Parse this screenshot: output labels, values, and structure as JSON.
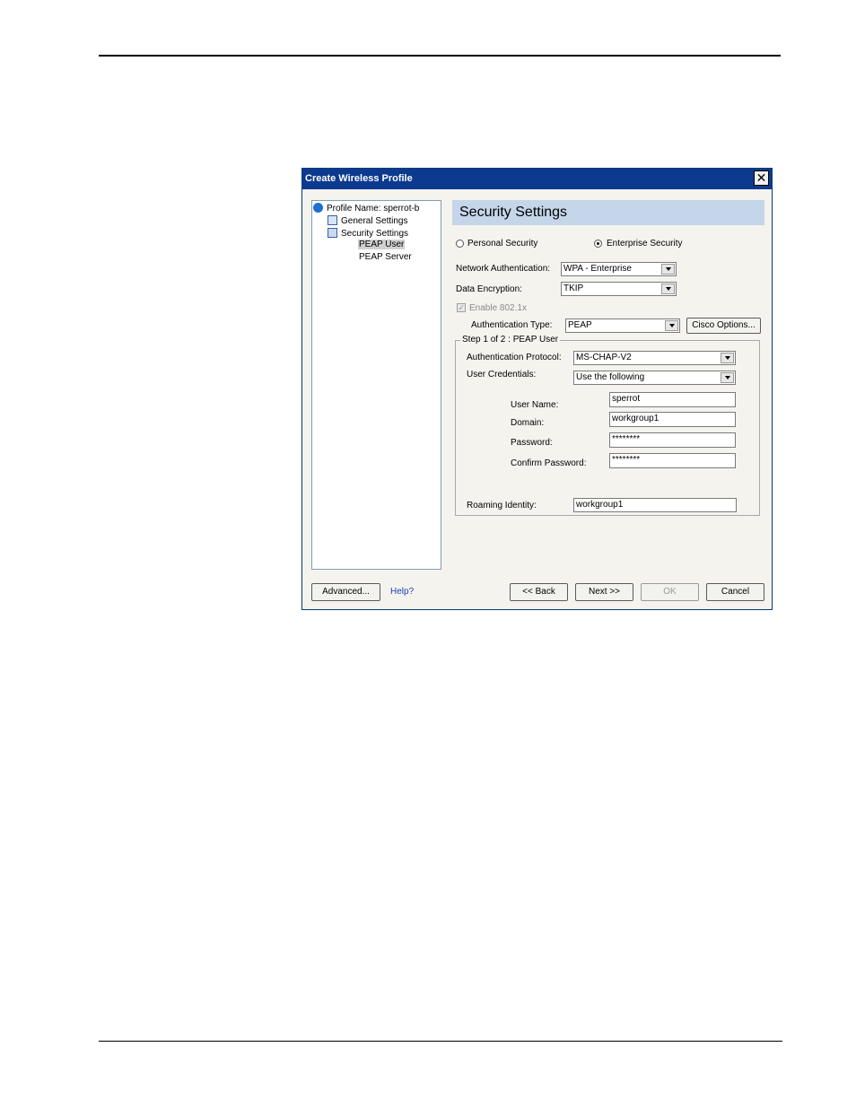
{
  "window": {
    "title": "Create Wireless Profile",
    "close_glyph": "✕"
  },
  "tree": {
    "items": [
      {
        "label": "Profile Name: sperrot-b",
        "icon": "wifi-icon"
      },
      {
        "label": "General Settings",
        "icon": "settings-doc-icon"
      },
      {
        "label": "Security Settings",
        "icon": "lock-icon"
      },
      {
        "label": "PEAP User",
        "selected": true
      },
      {
        "label": "PEAP Server"
      }
    ]
  },
  "header": {
    "title": "Security Settings"
  },
  "security_mode": {
    "personal_label": "Personal Security",
    "enterprise_label": "Enterprise Security",
    "selected": "enterprise"
  },
  "network_auth": {
    "label": "Network Authentication:",
    "value": "WPA - Enterprise"
  },
  "data_encryption": {
    "label": "Data Encryption:",
    "value": "TKIP"
  },
  "enable_8021x": {
    "label": "Enable 802.1x",
    "checked": true,
    "disabled": true
  },
  "auth_type": {
    "label": "Authentication Type:",
    "value": "PEAP"
  },
  "cisco_options_label": "Cisco Options...",
  "step_group": {
    "legend": "Step 1 of 2 : PEAP User",
    "auth_protocol": {
      "label": "Authentication Protocol:",
      "value": "MS-CHAP-V2"
    },
    "user_credentials": {
      "label": "User Credentials:",
      "value": "Use the following"
    },
    "user_name": {
      "label": "User Name:",
      "value": "sperrot"
    },
    "domain": {
      "label": "Domain:",
      "value": "workgroup1"
    },
    "password": {
      "label": "Password:",
      "value": "********"
    },
    "confirm_password": {
      "label": "Confirm Password:",
      "value": "********"
    },
    "roaming_identity": {
      "label": "Roaming Identity:",
      "value": "workgroup1"
    }
  },
  "footer": {
    "advanced_label": "Advanced...",
    "help_label": "Help?",
    "back_label": "<< Back",
    "next_label": "Next >>",
    "ok_label": "OK",
    "cancel_label": "Cancel"
  }
}
